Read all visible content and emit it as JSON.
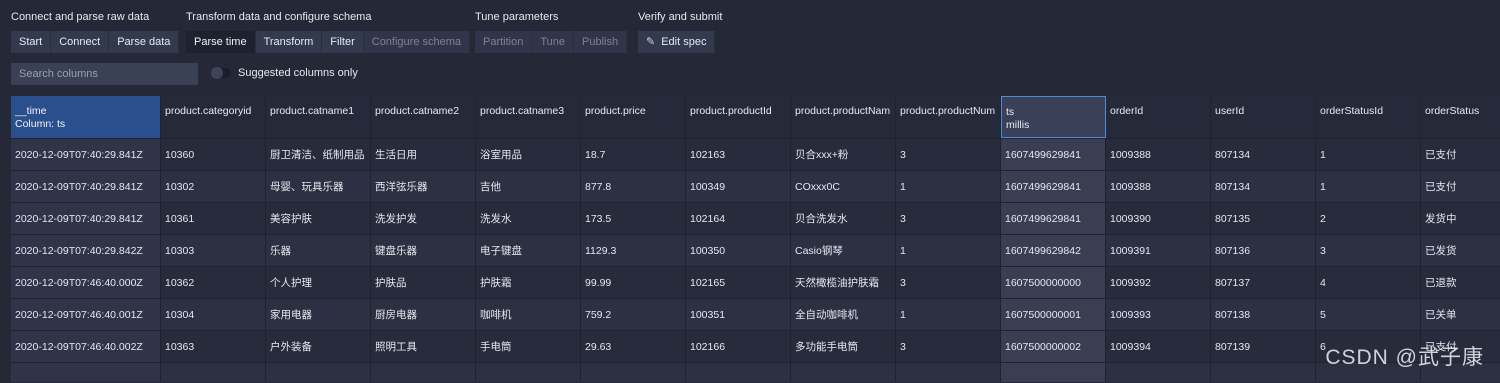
{
  "stages": [
    {
      "label": "Connect and parse raw data",
      "buttons": [
        {
          "label": "Start",
          "state": "normal"
        },
        {
          "label": "Connect",
          "state": "normal"
        },
        {
          "label": "Parse data",
          "state": "normal"
        }
      ]
    },
    {
      "label": "Transform data and configure schema",
      "buttons": [
        {
          "label": "Parse time",
          "state": "active"
        },
        {
          "label": "Transform",
          "state": "normal"
        },
        {
          "label": "Filter",
          "state": "normal"
        },
        {
          "label": "Configure schema",
          "state": "disabled"
        }
      ]
    },
    {
      "label": "Tune parameters",
      "buttons": [
        {
          "label": "Partition",
          "state": "disabled"
        },
        {
          "label": "Tune",
          "state": "disabled"
        },
        {
          "label": "Publish",
          "state": "disabled"
        }
      ]
    },
    {
      "label": "Verify and submit",
      "buttons": [
        {
          "label": "Edit spec",
          "state": "normal",
          "icon": "edit-icon"
        }
      ]
    }
  ],
  "search": {
    "placeholder": "Search columns",
    "value": ""
  },
  "suggested_toggle": {
    "label": "Suggested columns only",
    "on": false
  },
  "columns": [
    {
      "name": "__time",
      "sub": "Column: ts"
    },
    {
      "name": "product.categoryid",
      "sub": ""
    },
    {
      "name": "product.catname1",
      "sub": ""
    },
    {
      "name": "product.catname2",
      "sub": ""
    },
    {
      "name": "product.catname3",
      "sub": ""
    },
    {
      "name": "product.price",
      "sub": ""
    },
    {
      "name": "product.productId",
      "sub": ""
    },
    {
      "name": "product.productNam",
      "sub": ""
    },
    {
      "name": "product.productNum",
      "sub": ""
    },
    {
      "name": "ts",
      "sub": "millis"
    },
    {
      "name": "orderId",
      "sub": ""
    },
    {
      "name": "userId",
      "sub": ""
    },
    {
      "name": "orderStatusId",
      "sub": ""
    },
    {
      "name": "orderStatus",
      "sub": ""
    }
  ],
  "rows": [
    [
      "2020-12-09T07:40:29.841Z",
      "10360",
      "厨卫清洁、纸制用品",
      "生活日用",
      "浴室用品",
      "18.7",
      "102163",
      "贝合xxx+粉",
      "3",
      "1607499629841",
      "1009388",
      "807134",
      "1",
      "已支付"
    ],
    [
      "2020-12-09T07:40:29.841Z",
      "10302",
      "母婴、玩具乐器",
      "西洋弦乐器",
      "吉他",
      "877.8",
      "100349",
      "COxxx0C",
      "1",
      "1607499629841",
      "1009388",
      "807134",
      "1",
      "已支付"
    ],
    [
      "2020-12-09T07:40:29.841Z",
      "10361",
      "美容护肤",
      "洗发护发",
      "洗发水",
      "173.5",
      "102164",
      "贝合洗发水",
      "3",
      "1607499629841",
      "1009390",
      "807135",
      "2",
      "发货中"
    ],
    [
      "2020-12-09T07:40:29.842Z",
      "10303",
      "乐器",
      "键盘乐器",
      "电子键盘",
      "1129.3",
      "100350",
      "Casio钢琴",
      "1",
      "1607499629842",
      "1009391",
      "807136",
      "3",
      "已发货"
    ],
    [
      "2020-12-09T07:46:40.000Z",
      "10362",
      "个人护理",
      "护肤品",
      "护肤霜",
      "99.99",
      "102165",
      "天然橄榄油护肤霜",
      "3",
      "1607500000000",
      "1009392",
      "807137",
      "4",
      "已退款"
    ],
    [
      "2020-12-09T07:46:40.001Z",
      "10304",
      "家用电器",
      "厨房电器",
      "咖啡机",
      "759.2",
      "100351",
      "全自动咖啡机",
      "1",
      "1607500000001",
      "1009393",
      "807138",
      "5",
      "已关单"
    ],
    [
      "2020-12-09T07:46:40.002Z",
      "10363",
      "户外装备",
      "照明工具",
      "手电筒",
      "29.63",
      "102166",
      "多功能手电筒",
      "3",
      "1607500000002",
      "1009394",
      "807139",
      "6",
      "已支付"
    ]
  ],
  "watermark": "CSDN @武子康"
}
